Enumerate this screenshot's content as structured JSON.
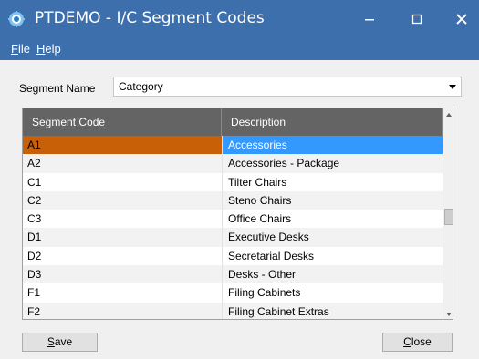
{
  "window": {
    "title": "PTDEMO - I/C Segment Codes",
    "controls": {
      "minimize": "minimize-icon",
      "maximize": "maximize-icon",
      "close": "close-icon"
    }
  },
  "menu": {
    "file": {
      "mnemonic": "F",
      "rest": "ile"
    },
    "help": {
      "mnemonic": "H",
      "rest": "elp"
    }
  },
  "segment": {
    "label": "Segment Name",
    "value": "Category"
  },
  "grid": {
    "columns": [
      "Segment Code",
      "Description"
    ],
    "selected_index": 0,
    "rows": [
      {
        "code": "A1",
        "description": "Accessories"
      },
      {
        "code": "A2",
        "description": "Accessories - Package"
      },
      {
        "code": "C1",
        "description": "Tilter Chairs"
      },
      {
        "code": "C2",
        "description": "Steno Chairs"
      },
      {
        "code": "C3",
        "description": "Office Chairs"
      },
      {
        "code": "D1",
        "description": "Executive Desks"
      },
      {
        "code": "D2",
        "description": "Secretarial Desks"
      },
      {
        "code": "D3",
        "description": "Desks - Other"
      },
      {
        "code": "F1",
        "description": "Filing Cabinets"
      },
      {
        "code": "F2",
        "description": "Filing Cabinet Extras"
      }
    ]
  },
  "buttons": {
    "save": {
      "mnemonic": "S",
      "rest": "ave"
    },
    "close": {
      "mnemonic": "C",
      "rest": "lose"
    }
  },
  "colors": {
    "titlebar": "#3d6fad",
    "header": "#646464",
    "selected_code": "#c8600a",
    "selected_desc": "#3399ff"
  }
}
